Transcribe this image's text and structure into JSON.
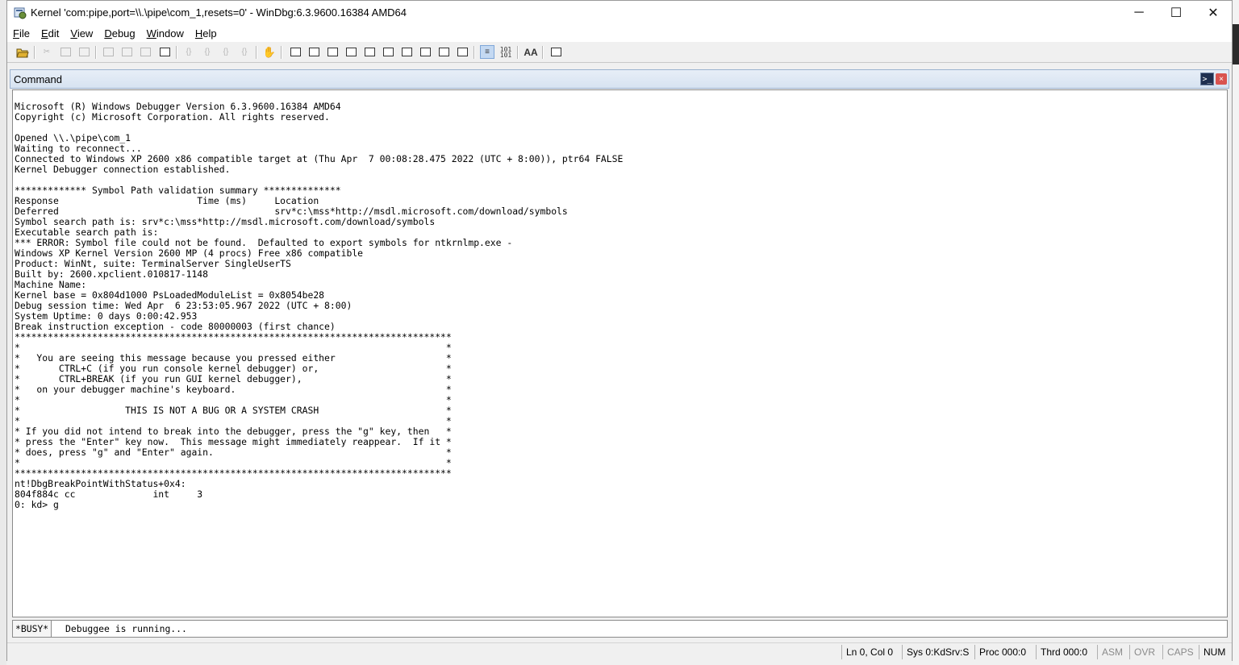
{
  "window": {
    "title": "Kernel 'com:pipe,port=\\\\.\\pipe\\com_1,resets=0' - WinDbg:6.3.9600.16384 AMD64",
    "min_glyph": "─",
    "max_glyph": "☐",
    "close_glyph": "✕"
  },
  "menu": [
    {
      "hotkey": "F",
      "rest": "ile"
    },
    {
      "hotkey": "E",
      "rest": "dit"
    },
    {
      "hotkey": "V",
      "rest": "iew"
    },
    {
      "hotkey": "D",
      "rest": "ebug"
    },
    {
      "hotkey": "W",
      "rest": "indow"
    },
    {
      "hotkey": "H",
      "rest": "elp"
    }
  ],
  "toolbar": {
    "source_mode_icon": "source-mode-icon",
    "hex_glyph": "101",
    "hex_glyph2": "101",
    "font_glyph": "AA"
  },
  "command_window": {
    "title": "Command",
    "icon_glyph": ">_",
    "close_glyph": "×",
    "output": "Microsoft (R) Windows Debugger Version 6.3.9600.16384 AMD64\nCopyright (c) Microsoft Corporation. All rights reserved.\n\nOpened \\\\.\\pipe\\com_1\nWaiting to reconnect...\nConnected to Windows XP 2600 x86 compatible target at (Thu Apr  7 00:08:28.475 2022 (UTC + 8:00)), ptr64 FALSE\nKernel Debugger connection established.\n\n************* Symbol Path validation summary **************\nResponse                         Time (ms)     Location\nDeferred                                       srv*c:\\mss*http://msdl.microsoft.com/download/symbols\nSymbol search path is: srv*c:\\mss*http://msdl.microsoft.com/download/symbols\nExecutable search path is:\n*** ERROR: Symbol file could not be found.  Defaulted to export symbols for ntkrnlmp.exe -\nWindows XP Kernel Version 2600 MP (4 procs) Free x86 compatible\nProduct: WinNt, suite: TerminalServer SingleUserTS\nBuilt by: 2600.xpclient.010817-1148\nMachine Name:\nKernel base = 0x804d1000 PsLoadedModuleList = 0x8054be28\nDebug session time: Wed Apr  6 23:53:05.967 2022 (UTC + 8:00)\nSystem Uptime: 0 days 0:00:42.953\nBreak instruction exception - code 80000003 (first chance)\n*******************************************************************************\n*                                                                             *\n*   You are seeing this message because you pressed either                    *\n*       CTRL+C (if you run console kernel debugger) or,                       *\n*       CTRL+BREAK (if you run GUI kernel debugger),                          *\n*   on your debugger machine's keyboard.                                      *\n*                                                                             *\n*                   THIS IS NOT A BUG OR A SYSTEM CRASH                       *\n*                                                                             *\n* If you did not intend to break into the debugger, press the \"g\" key, then   *\n* press the \"Enter\" key now.  This message might immediately reappear.  If it *\n* does, press \"g\" and \"Enter\" again.                                          *\n*                                                                             *\n*******************************************************************************\nnt!DbgBreakPointWithStatus+0x4:\n804f884c cc              int     3\n0: kd> g",
    "prompt": "*BUSY*",
    "input_value": "Debuggee is running..."
  },
  "status": {
    "ln_col": "Ln 0, Col 0",
    "sys": "Sys 0:KdSrv:S",
    "proc": "Proc 000:0",
    "thrd": "Thrd 000:0",
    "asm": "ASM",
    "ovr": "OVR",
    "caps": "CAPS",
    "num": "NUM"
  }
}
